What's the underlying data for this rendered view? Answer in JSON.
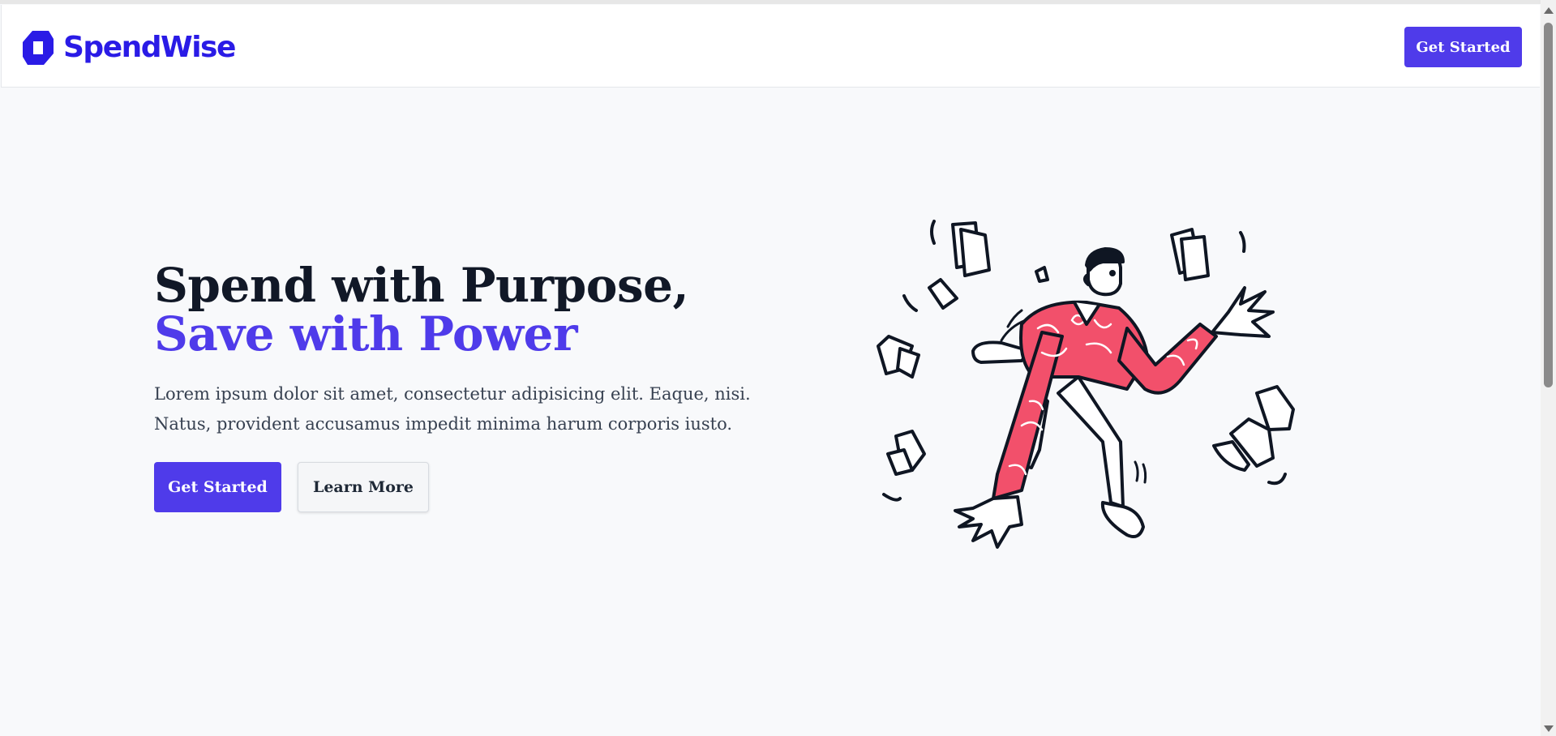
{
  "brand": {
    "name": "SpendWise",
    "color": "#2a1be6"
  },
  "nav": {
    "cta_label": "Get Started"
  },
  "hero": {
    "title_line1": "Spend with Purpose,",
    "title_line2": "Save with Power",
    "description": "Lorem ipsum dolor sit amet, consectetur adipisicing elit. Eaque, nisi. Natus, provident accusamus impedit minima harum corporis iusto.",
    "primary_button": "Get Started",
    "secondary_button": "Learn More",
    "illustration_icon": "person-juggling-papers-illustration"
  },
  "colors": {
    "accent": "#4f3bea",
    "heading": "#111827",
    "body_text": "#374151",
    "background": "#f8f9fb",
    "shirt": "#f2506b"
  }
}
